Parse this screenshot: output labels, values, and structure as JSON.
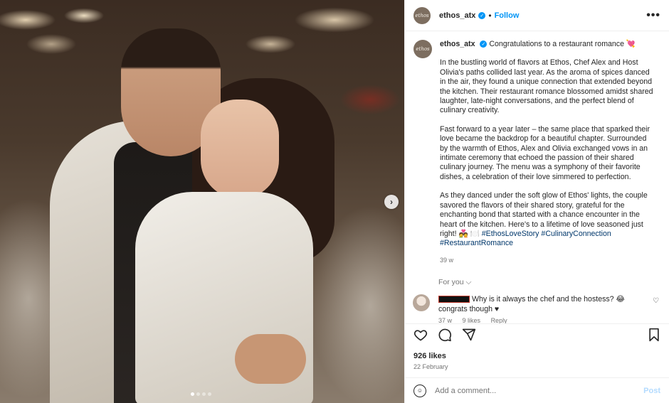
{
  "header": {
    "avatar_text": "ethos",
    "username": "ethos_atx",
    "verified_icon": "✓",
    "separator": "•",
    "follow": "Follow",
    "more": "•••"
  },
  "media": {
    "next_label": "›",
    "slides_total": 4,
    "active_slide": 1
  },
  "caption": {
    "avatar_text": "ethos",
    "username": "ethos_atx",
    "title": "Congratulations to a restaurant romance 💘",
    "p1": "In the bustling world of flavors at Ethos, Chef Alex and Host Olivia's paths collided last year. As the aroma of spices danced in the air, they found a unique connection that extended beyond the kitchen. Their restaurant romance blossomed amidst shared laughter, late-night conversations, and the perfect blend of culinary creativity.",
    "p2": "Fast forward to a year later – the same place that sparked their love became the backdrop for a beautiful chapter. Surrounded by the warmth of Ethos, Alex and Olivia exchanged vows in an intimate ceremony that echoed the passion of their shared culinary journey. The menu was a symphony of their favorite dishes, a celebration of their love simmered to perfection.",
    "p3": "As they danced under the soft glow of Ethos' lights, the couple savored the flavors of their shared story, grateful for the enchanting bond that started with a chance encounter in the heart of the kitchen. Here's to a lifetime of love seasoned just right! 💑 🍽️",
    "hashtags": [
      "#EthosLoveStory",
      "#CulinaryConnection",
      "#RestaurantRomance"
    ],
    "time": "39 w"
  },
  "for_you": "For you ⌵",
  "comment": {
    "text": "Why is it always the chef and the hostess? 😂",
    "text2": "congrats though ♥",
    "time": "37 w",
    "likes": "9 likes",
    "reply": "Reply",
    "like_icon": "♡"
  },
  "actions": {
    "like_icon": "heart-icon",
    "comment_icon": "comment-icon",
    "share_icon": "share-icon",
    "save_icon": "bookmark-icon"
  },
  "likes": "926 likes",
  "date": "22 February",
  "composer": {
    "emoji": "☺",
    "placeholder": "Add a comment...",
    "post": "Post"
  }
}
